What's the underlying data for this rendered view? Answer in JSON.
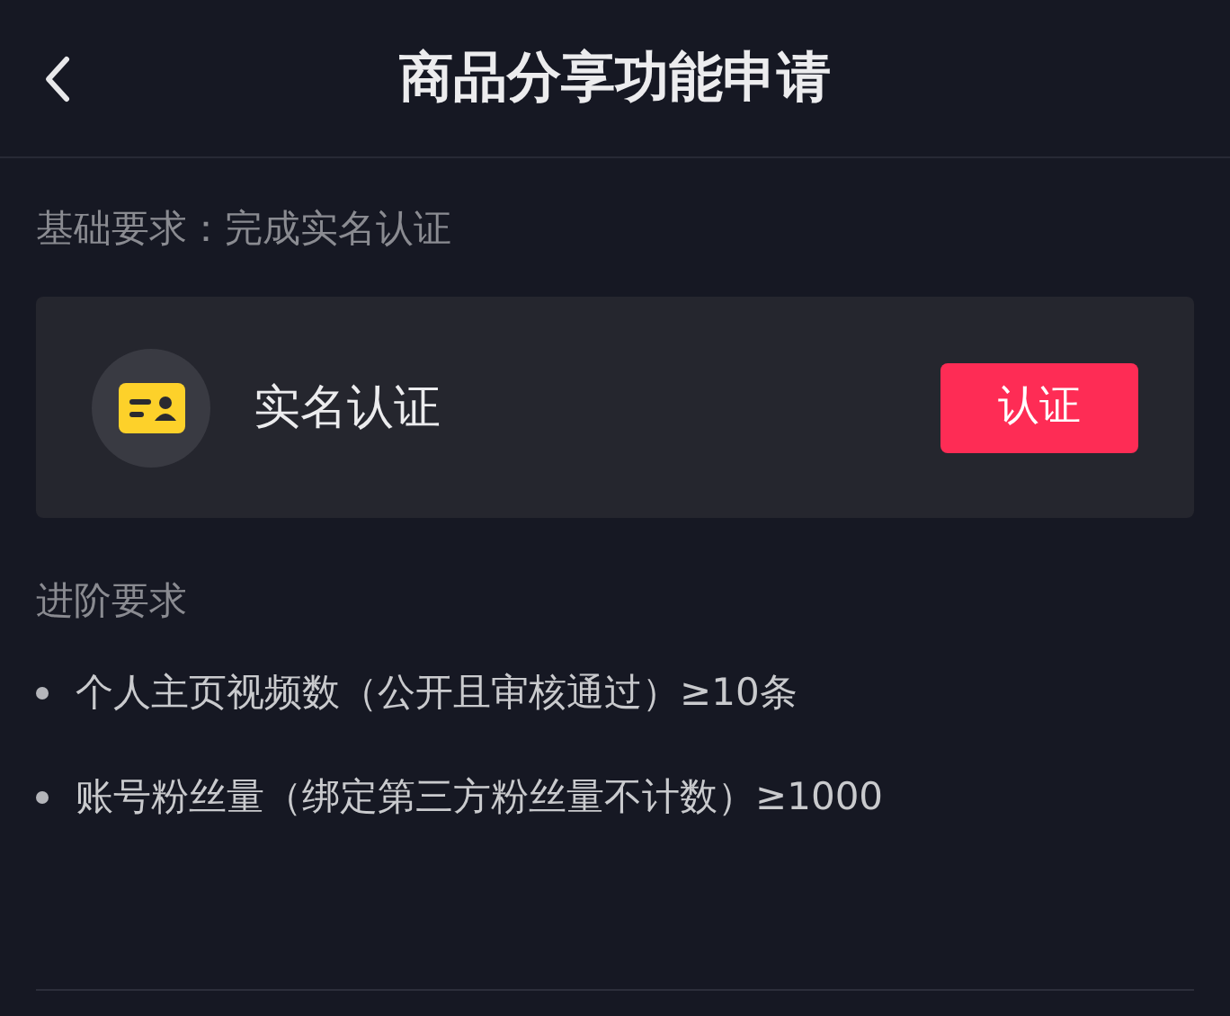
{
  "header": {
    "title": "商品分享功能申请"
  },
  "basic": {
    "label": "基础要求：完成实名认证",
    "card": {
      "title": "实名认证",
      "button": "认证"
    }
  },
  "advanced": {
    "label": "进阶要求",
    "items": [
      "个人主页视频数（公开且审核通过）≥10条",
      "账号粉丝量（绑定第三方粉丝量不计数）≥1000"
    ]
  }
}
